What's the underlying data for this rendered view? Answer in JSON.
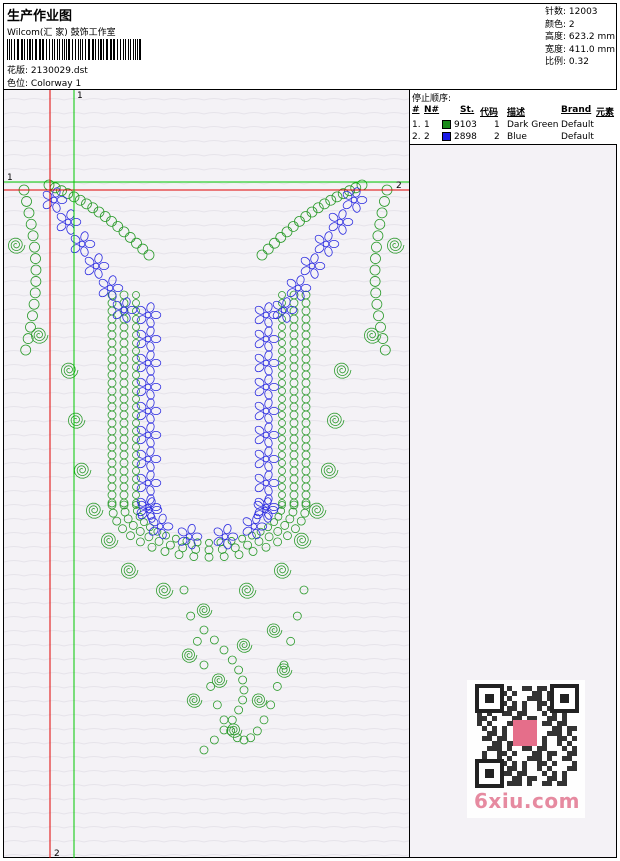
{
  "header": {
    "title": "生产作业图",
    "studio": "Wilcom(汇 家) 鼓饰工作室",
    "pattern_label": "花版:",
    "pattern_value": "2130029.dst",
    "colorway_label": "色位:",
    "colorway_value": "Colorway 1"
  },
  "stats": {
    "stitches": "针数: 12003",
    "colors": "颜色: 2",
    "height": "高度: 623.2 mm",
    "width": "宽度: 411.0 mm",
    "scale": "比例: 0.32"
  },
  "stop_sequence": {
    "title": "停止顺序:",
    "columns": [
      "#",
      "N#",
      "St.",
      "代码",
      "描述",
      "Brand",
      "元素"
    ],
    "rows": [
      {
        "index": "1.",
        "needle": "1",
        "stitch_code": "9103",
        "code": "1",
        "description": "Dark Green",
        "brand": "Default",
        "color": "#1a8a1a"
      },
      {
        "index": "2.",
        "needle": "2",
        "stitch_code": "2898",
        "code": "2",
        "description": "Blue",
        "brand": "Default",
        "color": "#1a1ae6"
      }
    ]
  },
  "guides": {
    "h1": "1",
    "h2": "2",
    "v1": "1",
    "v2": "2",
    "green": "#00c800",
    "red": "#e00000"
  },
  "colors": {
    "thread_green": "#2a9a2a",
    "thread_blue": "#2a2ae0"
  },
  "watermark": {
    "text": "6xiu.com"
  }
}
